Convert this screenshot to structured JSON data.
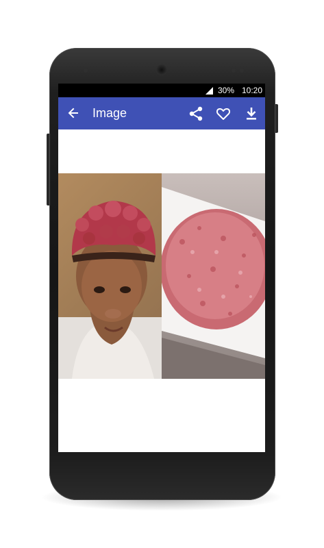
{
  "status_bar": {
    "battery": "30%",
    "time": "10:20"
  },
  "app_bar": {
    "title": "Image",
    "color": "#3f51b5",
    "back_icon": "arrow-left-icon",
    "actions": [
      {
        "name": "share",
        "icon": "share-icon"
      },
      {
        "name": "favorite",
        "icon": "heart-outline-icon"
      },
      {
        "name": "download",
        "icon": "download-icon"
      }
    ]
  },
  "content": {
    "image_panels": [
      {
        "name": "left-photo",
        "subject": "person-with-curly-red-hair"
      },
      {
        "name": "right-photo",
        "subject": "ground-meat-patty"
      }
    ]
  }
}
